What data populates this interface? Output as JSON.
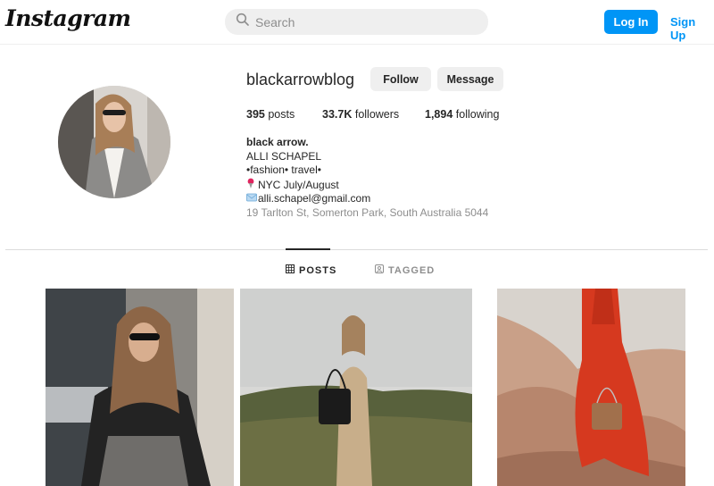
{
  "header": {
    "logo_text": "Instagram",
    "search_placeholder": "Search",
    "login_label": "Log In",
    "signup_label": "Sign Up"
  },
  "profile": {
    "username": "blackarrowblog",
    "follow_label": "Follow",
    "message_label": "Message",
    "stats": {
      "posts_count": "395",
      "posts_label": "posts",
      "followers_count": "33.7K",
      "followers_label": "followers",
      "following_count": "1,894",
      "following_label": "following"
    },
    "bio": {
      "name": "black arrow.",
      "line1": "ALLI SCHAPEL",
      "line2": "•fashion• travel•",
      "line3": "NYC July/August",
      "line4": "alli.schapel@gmail.com",
      "address": "19 Tarlton St, Somerton Park, South Australia 5044"
    }
  },
  "tabs": [
    {
      "label": "POSTS",
      "icon": "grid-icon",
      "active": true
    },
    {
      "label": "TAGGED",
      "icon": "tag-icon",
      "active": false
    }
  ],
  "colors": {
    "accent": "#0095f6",
    "text": "#262626",
    "muted": "#8e8e8e",
    "button_gray": "#efefef"
  },
  "icons": [
    "search-icon",
    "pin-icon",
    "mail-icon",
    "grid-icon",
    "tag-icon"
  ]
}
